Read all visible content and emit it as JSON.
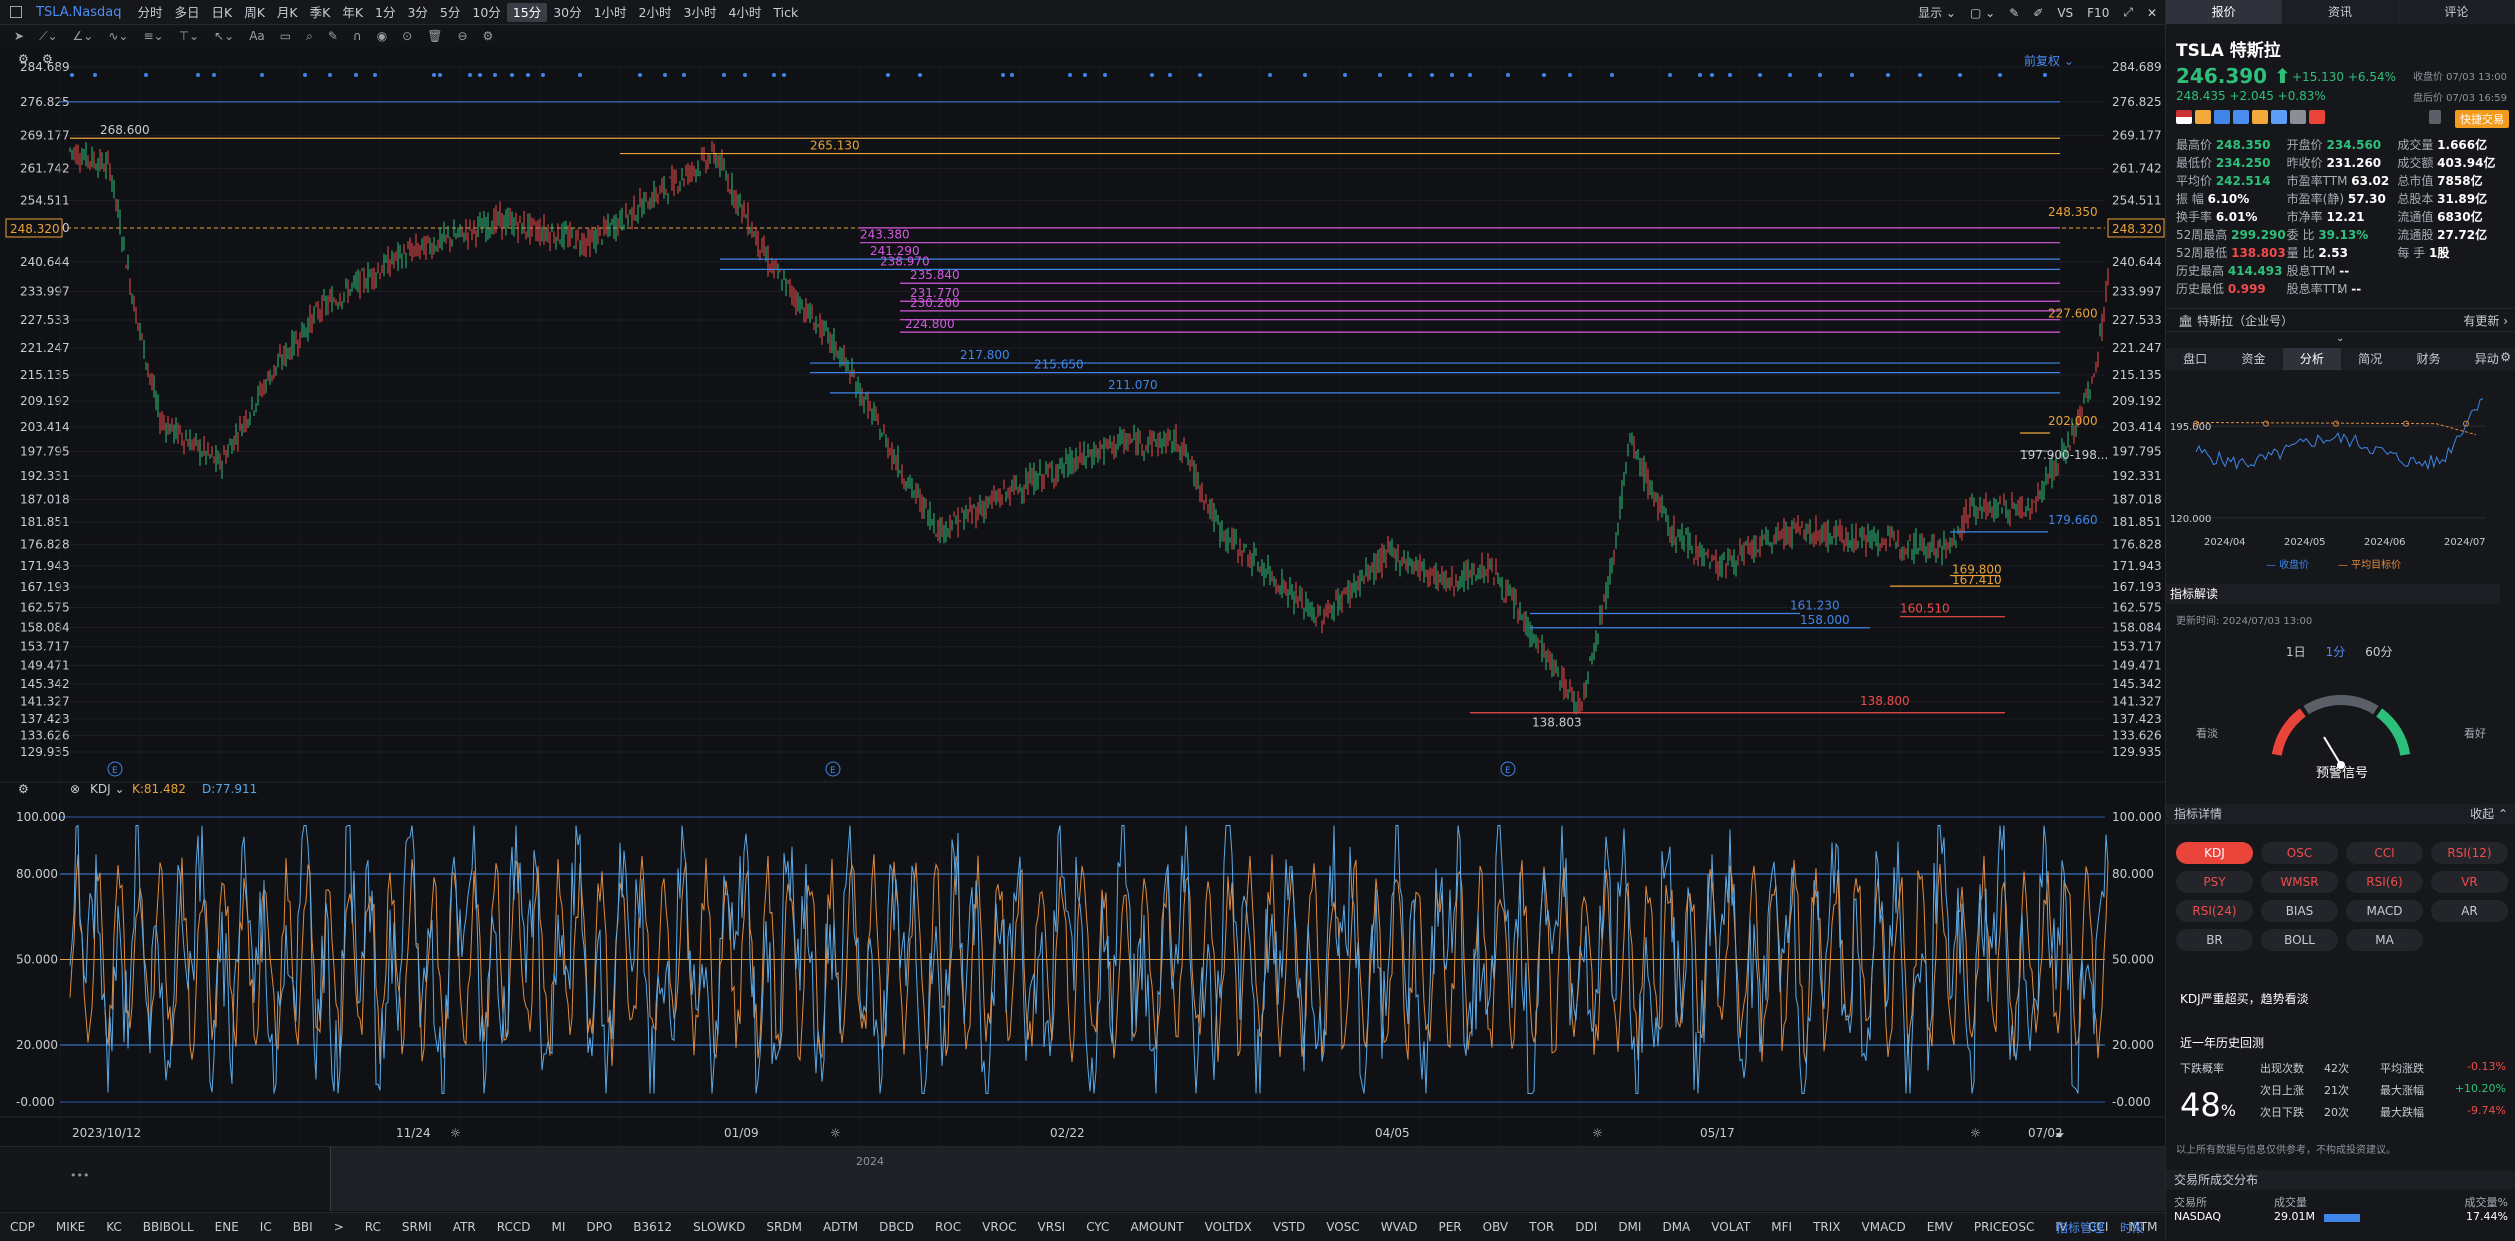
{
  "symbol_title": "TSLA.Nasdaq",
  "timeframes": [
    "分时",
    "多日",
    "日K",
    "周K",
    "月K",
    "季K",
    "年K",
    "1分",
    "3分",
    "5分",
    "10分",
    "15分",
    "30分",
    "1小时",
    "2小时",
    "3小时",
    "4小时",
    "Tick"
  ],
  "active_timeframe": "15分",
  "topright": {
    "display": "显示",
    "vs": "VS",
    "f10": "F10"
  },
  "price_axis": [
    "284.689",
    "276.825",
    "269.177",
    "261.742",
    "254.511",
    "248.320",
    "240.644",
    "233.997",
    "227.533",
    "221.247",
    "215.135",
    "209.192",
    "203.414",
    "197.795",
    "192.331",
    "187.018",
    "181.851",
    "176.828",
    "171.943",
    "167.193",
    "162.575",
    "158.084",
    "153.717",
    "149.471",
    "145.342",
    "141.327",
    "137.423",
    "133.626",
    "129.935"
  ],
  "current_price_label": "248.320",
  "adjust_label": "前复权",
  "annotations": {
    "a268": "268.600",
    "a265": "265.130",
    "a2483": "248.350",
    "a243": "243.380",
    "a241": "241.290",
    "a238": "238.970",
    "a235": "235.840",
    "a231": "231.770",
    "a230": "230.200",
    "a227": "227.600",
    "a224": "224.800",
    "a217": "217.800",
    "a215": "215.650",
    "a211": "211.070",
    "a202": "202.000",
    "a197": "197.900-198...",
    "a179": "179.660",
    "a169": "169.800",
    "a167": "167.410",
    "a161": "161.230",
    "a160": "160.510",
    "a158": "158.000",
    "a138": "138.800",
    "alow": "138.803"
  },
  "kdj": {
    "label": "KDJ",
    "k": "K:81.482",
    "d": "D:77.911"
  },
  "kdj_axis": [
    "100.000",
    "80.000",
    "50.000",
    "20.000",
    "-0.000"
  ],
  "date_axis": [
    "2023/10/12",
    "11/24",
    "01/09",
    "02/22",
    "04/05",
    "05/17",
    "07/02"
  ],
  "year_label": "2024",
  "bottom_indicators": [
    "CDP",
    "MIKE",
    "KC",
    "BBIBOLL",
    "ENE",
    "IC",
    "BBI",
    ">",
    "RC",
    "SRMI",
    "ATR",
    "RCCD",
    "MI",
    "DPO",
    "B3612",
    "SLOWKD",
    "SRDM",
    "ADTM",
    "DBCD",
    "ROC",
    "VROC",
    "VRSI",
    "CYC",
    "AMOUNT",
    "VOLTDX",
    "VSTD",
    "VOSC",
    "WVAD",
    "PER",
    "OBV",
    "TOR",
    "DDI",
    "DMI",
    "DMA",
    "VOLAT",
    "MFI",
    "TRIX",
    "VMACD",
    "EMV",
    "PRICEOSC",
    "IV",
    "CCI",
    "MTM"
  ],
  "bottom_right": {
    "manage": "指标管理",
    "more": "时段"
  },
  "rp": {
    "tabs": [
      "报价",
      "资讯",
      "评论"
    ],
    "ticker": "TSLA  特斯拉",
    "price": "246.390",
    "change": "+15.130  +6.54%",
    "close_time": "收盘价 07/03 13:00",
    "after": "248.435  +2.045  +0.83%",
    "after_time": "盘后价 07/03 16:59",
    "fast": "快捷交易",
    "stats": [
      [
        [
          "最高价",
          "248.350",
          "g"
        ],
        [
          "开盘价",
          "234.560",
          "g"
        ],
        [
          "成交量",
          "1.666亿",
          ""
        ]
      ],
      [
        [
          "最低价",
          "234.250",
          "g"
        ],
        [
          "昨收价",
          "231.260",
          ""
        ],
        [
          "成交额",
          "403.94亿",
          ""
        ]
      ],
      [
        [
          "平均价",
          "242.514",
          "g"
        ],
        [
          "市盈率TTM",
          "63.02",
          ""
        ],
        [
          "总市值",
          "7858亿",
          ""
        ]
      ],
      [
        [
          "振  幅",
          "6.10%",
          ""
        ],
        [
          "市盈率(静)",
          "57.30",
          ""
        ],
        [
          "总股本",
          "31.89亿",
          ""
        ]
      ],
      [
        [
          "换手率",
          "6.01%",
          ""
        ],
        [
          "市净率",
          "12.21",
          ""
        ],
        [
          "流通值",
          "6830亿",
          ""
        ]
      ],
      [
        [
          "52周最高",
          "299.290",
          "g"
        ],
        [
          "委  比",
          "39.13%",
          "g"
        ],
        [
          "流通股",
          "27.72亿",
          ""
        ]
      ],
      [
        [
          "52周最低",
          "138.803",
          "r"
        ],
        [
          "量  比",
          "2.53",
          ""
        ],
        [
          "每  手",
          "1股",
          ""
        ]
      ],
      [
        [
          "历史最高",
          "414.493",
          "g"
        ],
        [
          "股息TTM",
          "--",
          ""
        ],
        [
          "",
          "",
          ""
        ]
      ],
      [
        [
          "历史最低",
          "0.999",
          "r"
        ],
        [
          "股息率TTM",
          "--",
          ""
        ],
        [
          "",
          "",
          ""
        ]
      ]
    ],
    "company": "特斯拉（企业号）",
    "company_update": "有更新",
    "sub_tabs": [
      "盘口",
      "资金",
      "分析",
      "简况",
      "财务",
      "异动"
    ],
    "active_sub": "分析",
    "target": {
      "y_labels": [
        "195.000",
        "120.000"
      ],
      "x_labels": [
        "2024/04",
        "2024/05",
        "2024/06",
        "2024/07"
      ],
      "legend": [
        "收盘价",
        "平均目标价"
      ]
    },
    "interp_title": "指标解读",
    "interp_time": "更新时间: 2024/07/03 13:00",
    "periods": [
      "1日",
      "1分",
      "60分"
    ],
    "gauge_left": "看淡",
    "gauge_right": "看好",
    "signal": "预警信号",
    "detail_title": "指标详情",
    "collapse": "收起",
    "indicators": [
      [
        "KDJ",
        "sel"
      ],
      [
        "OSC",
        "red"
      ],
      [
        "CCI",
        "red"
      ],
      [
        "RSI(12)",
        "red"
      ],
      [
        "PSY",
        "red"
      ],
      [
        "WMSR",
        "red"
      ],
      [
        "RSI(6)",
        "red"
      ],
      [
        "VR",
        "red"
      ],
      [
        "RSI(24)",
        "red"
      ],
      [
        "BIAS",
        ""
      ],
      [
        "MACD",
        ""
      ],
      [
        "AR",
        ""
      ],
      [
        "BR",
        ""
      ],
      [
        "BOLL",
        ""
      ],
      [
        "MA",
        ""
      ]
    ],
    "kdj_note": "KDJ严重超买，趋势看淡",
    "hist_title": "近一年历史回测",
    "hist": {
      "label": "下跌概率",
      "pct": "48",
      "unit": "%",
      "rows": [
        [
          "出现次数",
          "42次",
          "平均涨跌",
          "-0.13%"
        ],
        [
          "次日上涨",
          "21次",
          "最大涨幅",
          "+10.20%"
        ],
        [
          "次日下跌",
          "20次",
          "最大跌幅",
          "-9.74%"
        ]
      ]
    },
    "disclaimer": "以上所有数据与信息仅供参考，不构成投资建议。",
    "dist_title": "交易所成交分布",
    "dist_head": [
      "交易所",
      "成交量",
      "成交量%"
    ],
    "dist_row": [
      "NASDAQ",
      "29.01M",
      "17.44%"
    ]
  },
  "colors": {
    "bg": "#101115",
    "up": "#2dc07a",
    "down": "#f04b4b",
    "blue": "#3f86e8",
    "orange": "#e8a23a",
    "magenta": "#d55ae0",
    "k_line": "#5aa9e6",
    "d_line": "#e08a3c"
  }
}
